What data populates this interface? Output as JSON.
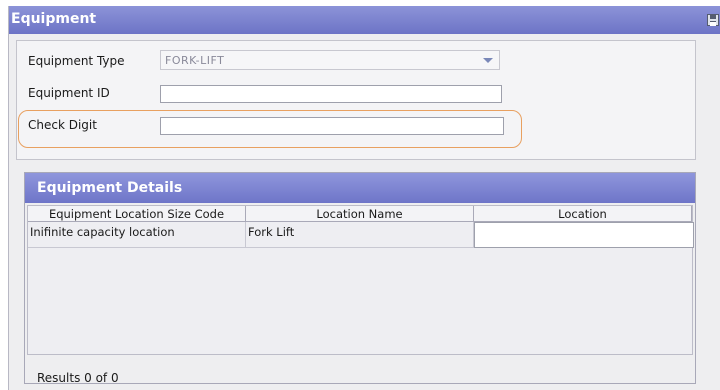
{
  "window": {
    "title": "Equipment"
  },
  "form": {
    "equipment_type_label": "Equipment Type",
    "equipment_type_value": "FORK-LIFT",
    "equipment_id_label": "Equipment ID",
    "equipment_id_value": "",
    "check_digit_label": "Check Digit",
    "check_digit_value": ""
  },
  "details": {
    "title": "Equipment Details",
    "columns": [
      "Equipment Location Size Code",
      "Location Name",
      "Location"
    ],
    "rows": [
      {
        "size_code": "Inifinite capacity location",
        "location_name": "Fork Lift",
        "location": ""
      }
    ],
    "results_text": "Results  0 of  0"
  },
  "colors": {
    "header_blue": "#7077c8",
    "highlight_orange": "#e8a060"
  }
}
